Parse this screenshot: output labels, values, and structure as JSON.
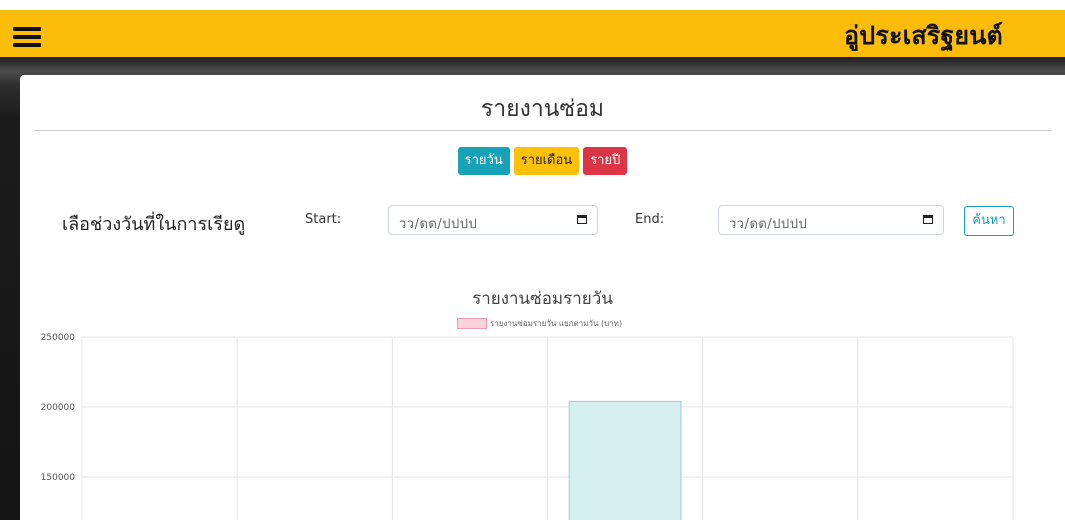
{
  "header": {
    "brand": "อู่ประเสริฐยนต์",
    "menu_icon": "hamburger-icon",
    "background": "#fbbd0a"
  },
  "page": {
    "title": "รายงานซ่อม"
  },
  "period_buttons": [
    {
      "label": "รายวัน",
      "color": "#17a2b8"
    },
    {
      "label": "รายเดือน",
      "color": "#ffc107"
    },
    {
      "label": "รายปี",
      "color": "#dc3545"
    }
  ],
  "filter": {
    "range_label": "เลือช่วงวันที่ในการเรียดู",
    "start_label": "Start:",
    "start_placeholder": "วว/ดด/ปปปป",
    "end_label": "End:",
    "end_placeholder": "วว/ดด/ปปปป",
    "search_label": "ค้นหา",
    "calendar_icon": "calendar-icon"
  },
  "chart_data": {
    "type": "bar",
    "title": "รายงานซ่อมรายวัน",
    "legend": [
      {
        "label": "รายงานซ่อมรายวัน แยกตามวัน (บาท)",
        "color": "#fbd3dc"
      }
    ],
    "y_ticks": [
      "250000",
      "200000",
      "150000"
    ],
    "ylim": [
      120000,
      250000
    ],
    "grid": true,
    "categories": [
      "",
      "",
      "",
      "",
      "",
      ""
    ],
    "series": [
      {
        "name": "รายงานซ่อมรายวัน แยกตามวัน (บาท)",
        "values": [
          null,
          null,
          null,
          204000,
          null,
          null
        ],
        "color": "#d6eff1",
        "border": "#8fd2d8"
      }
    ]
  }
}
